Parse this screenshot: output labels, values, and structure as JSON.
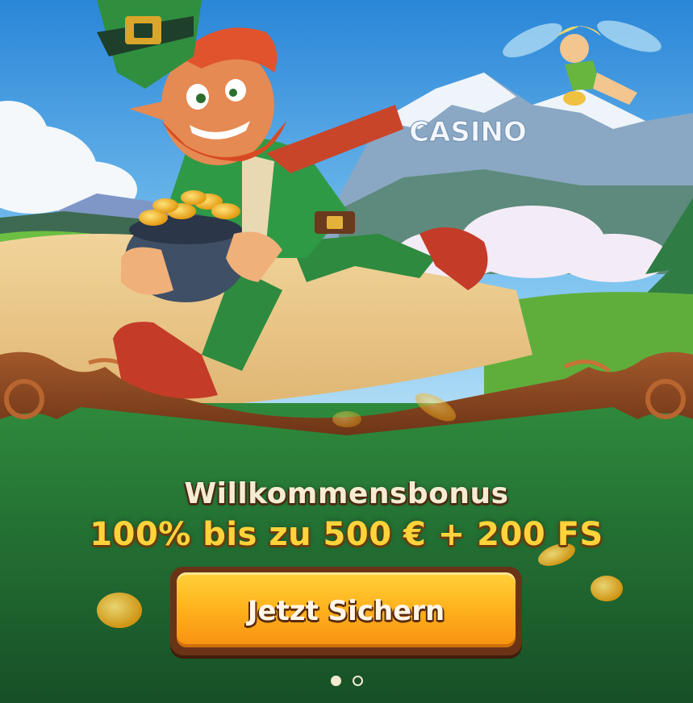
{
  "scene": {
    "mountain_sign": "CASINO"
  },
  "promo": {
    "title": "Willkommensbonus",
    "offer": "100% bis zu 500 € + 200 FS",
    "cta_label": "Jetzt Sichern"
  },
  "carousel": {
    "total_slides": 2,
    "active_slide": 1
  },
  "colors": {
    "sky_top": "#2e8fdc",
    "grass": "#1f6a33",
    "offer_text": "#ffd43b",
    "button": "#ffb41f",
    "wood": "#8a4a22"
  }
}
